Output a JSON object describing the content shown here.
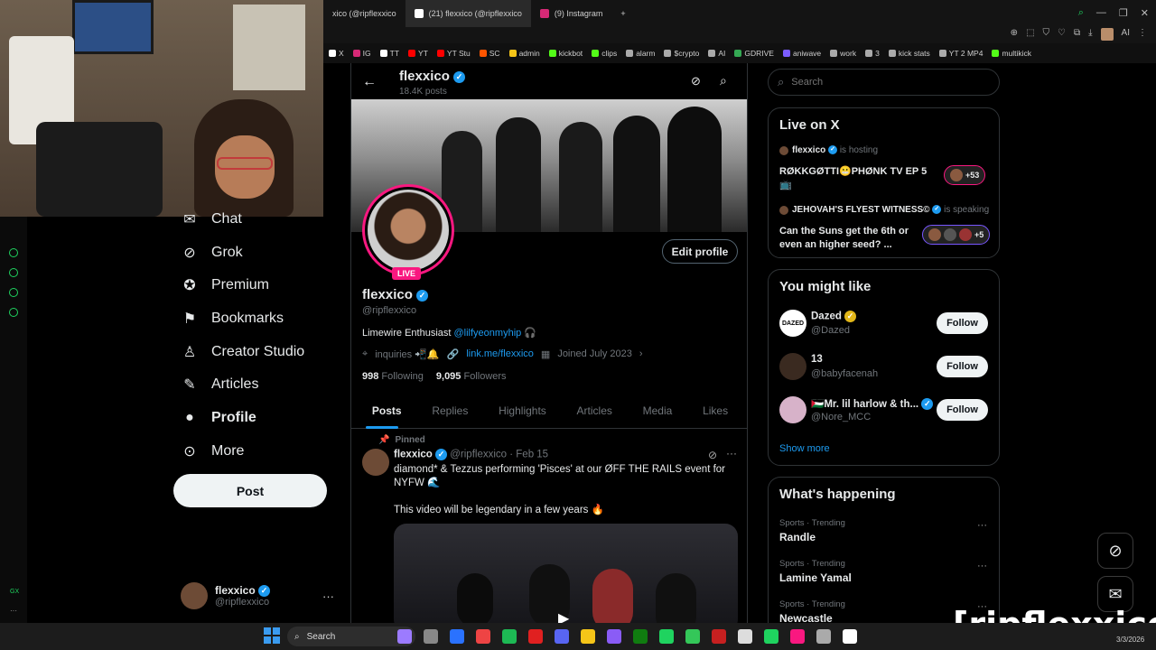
{
  "browser": {
    "tabs": [
      {
        "label": "xico (@ripflexxico",
        "active": false
      },
      {
        "label": "(21) flexxico (@ripflexxico",
        "active": true
      },
      {
        "label": "(9) Instagram",
        "active": false
      }
    ],
    "new_tab": "+",
    "bookmarks": [
      "X",
      "IG",
      "TT",
      "YT",
      "YT Stu",
      "SC",
      "admin",
      "kickbot",
      "clips",
      "alarm",
      "$crypto",
      "AI",
      "GDRIVE",
      "aniwave",
      "work",
      "3",
      "kick stats",
      "YT 2 MP4",
      "multikick"
    ],
    "toolbar_ai": "AI"
  },
  "gx": {
    "label": "GX",
    "more": "···"
  },
  "nav": {
    "items": [
      {
        "label": "Chat",
        "icon": "chat-icon"
      },
      {
        "label": "Grok",
        "icon": "grok-icon"
      },
      {
        "label": "Premium",
        "icon": "premium-icon"
      },
      {
        "label": "Bookmarks",
        "icon": "bookmark-icon"
      },
      {
        "label": "Creator Studio",
        "icon": "creator-icon"
      },
      {
        "label": "Articles",
        "icon": "articles-icon"
      },
      {
        "label": "Profile",
        "icon": "profile-icon"
      },
      {
        "label": "More",
        "icon": "more-icon"
      }
    ],
    "post_label": "Post",
    "account": {
      "name": "flexxico",
      "handle": "@ripflexxico",
      "more": "···"
    }
  },
  "profile": {
    "header_name": "flexxico",
    "post_count": "18.4K posts",
    "live_badge": "LIVE",
    "edit_label": "Edit profile",
    "name": "flexxico",
    "handle": "@ripflexxico",
    "bio_text": "Limewire Enthusiast",
    "bio_link": "@lilfyeonmyhip",
    "bio_emoji": "🎧",
    "location": "inquiries 📲🔔",
    "website": "link.me/flexxico",
    "joined": "Joined July 2023",
    "following_count": "998",
    "following_label": "Following",
    "followers_count": "9,095",
    "followers_label": "Followers",
    "tabs": [
      "Posts",
      "Replies",
      "Highlights",
      "Articles",
      "Media",
      "Likes"
    ],
    "active_tab": "Posts"
  },
  "post": {
    "pinned": "Pinned",
    "name": "flexxico",
    "handle": "@ripflexxico",
    "date": "· Feb 15",
    "line1": "diamond* & Tezzus performing 'Pisces' at our ØFF THE RAILS event for",
    "line2": "NYFW 🌊",
    "line3": "This video will be legendary in a few years 🔥",
    "more": "···"
  },
  "search": {
    "placeholder": "Search"
  },
  "live": {
    "title": "Live on X",
    "spaces": [
      {
        "host": "flexxico",
        "status": "is hosting",
        "title_line1": "RØKKGØTTI😬PHØNK TV EP 5",
        "title_line2": "📺",
        "count": "+53"
      },
      {
        "host": "JEHOVAH'S FLYEST WITNESS©",
        "status": "is speaking",
        "title_line1": "Can the Suns get the 6th or",
        "title_line2": "even an higher seed? ...",
        "count": "+5"
      }
    ]
  },
  "suggest": {
    "title": "You might like",
    "users": [
      {
        "name": "Dazed",
        "handle": "@Dazed",
        "avatar_text": "DAZED",
        "verified": "gold"
      },
      {
        "name": "13",
        "handle": "@babyfacenah",
        "avatar_text": "",
        "verified": "none"
      },
      {
        "name": "🇵🇸Mr. lil harlow & th...",
        "handle": "@Nore_MCC",
        "avatar_text": "",
        "verified": "blue"
      }
    ],
    "follow_label": "Follow",
    "show_more": "Show more"
  },
  "trending": {
    "title": "What's happening",
    "items": [
      {
        "meta": "Sports · Trending",
        "name": "Randle"
      },
      {
        "meta": "Sports · Trending",
        "name": "Lamine Yamal"
      },
      {
        "meta": "Sports · Trending",
        "name": "Newcastle"
      }
    ],
    "more": "···"
  },
  "overlay": {
    "watermark": "[ripflexxico]"
  },
  "taskbar": {
    "search": "Search",
    "date": "3/3/2026"
  },
  "colors": {
    "accent": "#1d9bf0",
    "live": "#f91880",
    "bg": "#000000",
    "pill": "#eff3f4"
  }
}
